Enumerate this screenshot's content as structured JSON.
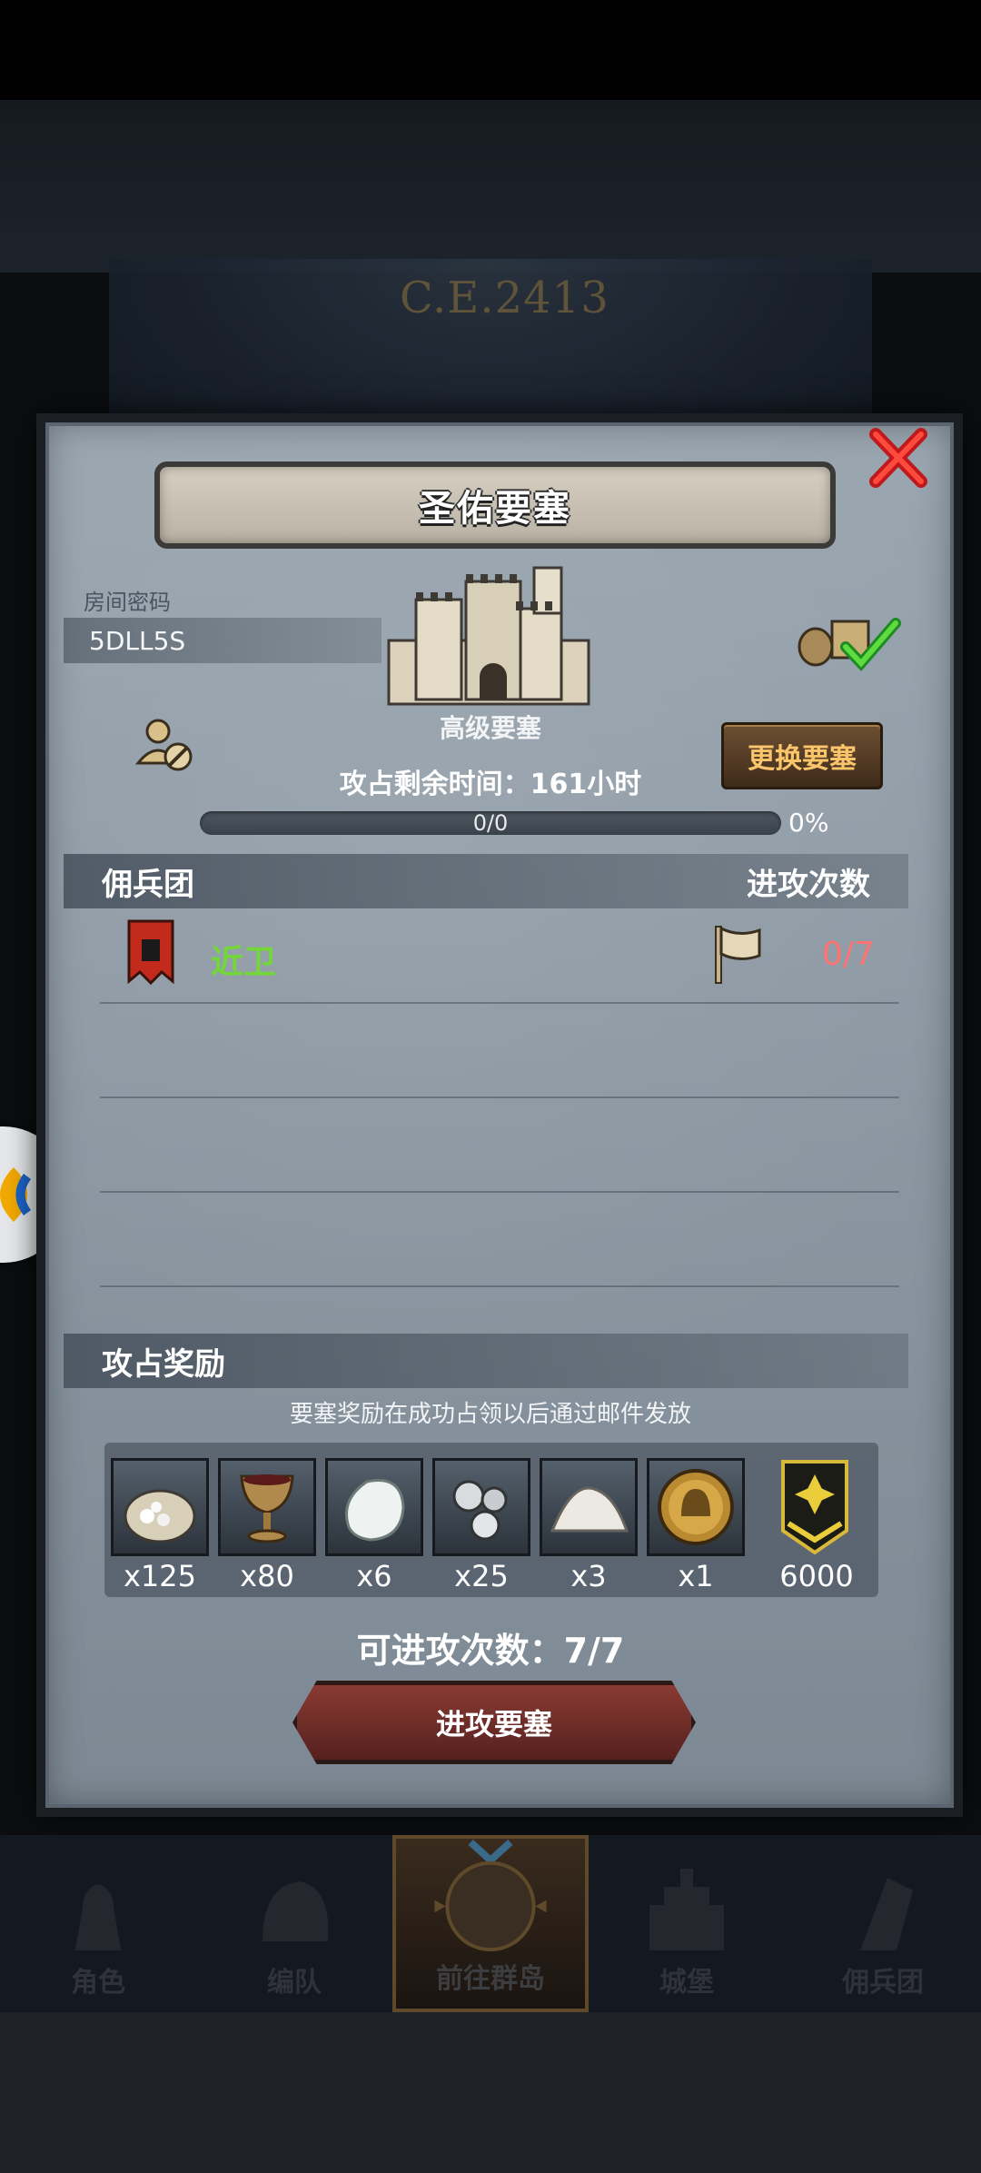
{
  "header": {
    "year": "C.E.2413"
  },
  "modal": {
    "title": "圣佑要塞",
    "room_code_label": "房间密码",
    "room_code": "5DLL5S",
    "fortress_level": "高级要塞",
    "change_button": "更换要塞",
    "time_left": "攻占剩余时间：161小时",
    "progress": {
      "text": "0/0",
      "percent_label": "0%",
      "value": 0
    },
    "guild_section": {
      "title": "佣兵团",
      "right_title": "进攻次数"
    },
    "guilds": [
      {
        "name": "近卫",
        "count": "0/7"
      }
    ],
    "rewards_section": {
      "title": "攻占奖励",
      "note": "要塞奖励在成功占领以后通过邮件发放"
    },
    "rewards": [
      {
        "icon": "ore-sack-icon",
        "qty": "x125"
      },
      {
        "icon": "goblet-icon",
        "qty": "x80"
      },
      {
        "icon": "white-stone-icon",
        "qty": "x6"
      },
      {
        "icon": "silver-pearls-icon",
        "qty": "x25"
      },
      {
        "icon": "salt-pile-icon",
        "qty": "x3"
      },
      {
        "icon": "helmet-coin-icon",
        "qty": "x1"
      },
      {
        "icon": "rank-badge-icon",
        "qty": "6000"
      }
    ],
    "attack_count": "可进攻次数：7/7",
    "attack_button": "进攻要塞"
  },
  "bottom_nav": [
    {
      "label": "角色",
      "icon": "knight-icon"
    },
    {
      "label": "编队",
      "icon": "helmet-icon"
    },
    {
      "label": "前往群岛",
      "icon": "island-icon",
      "active": true
    },
    {
      "label": "城堡",
      "icon": "castle-icon"
    },
    {
      "label": "佣兵团",
      "icon": "war-banner-icon"
    }
  ]
}
